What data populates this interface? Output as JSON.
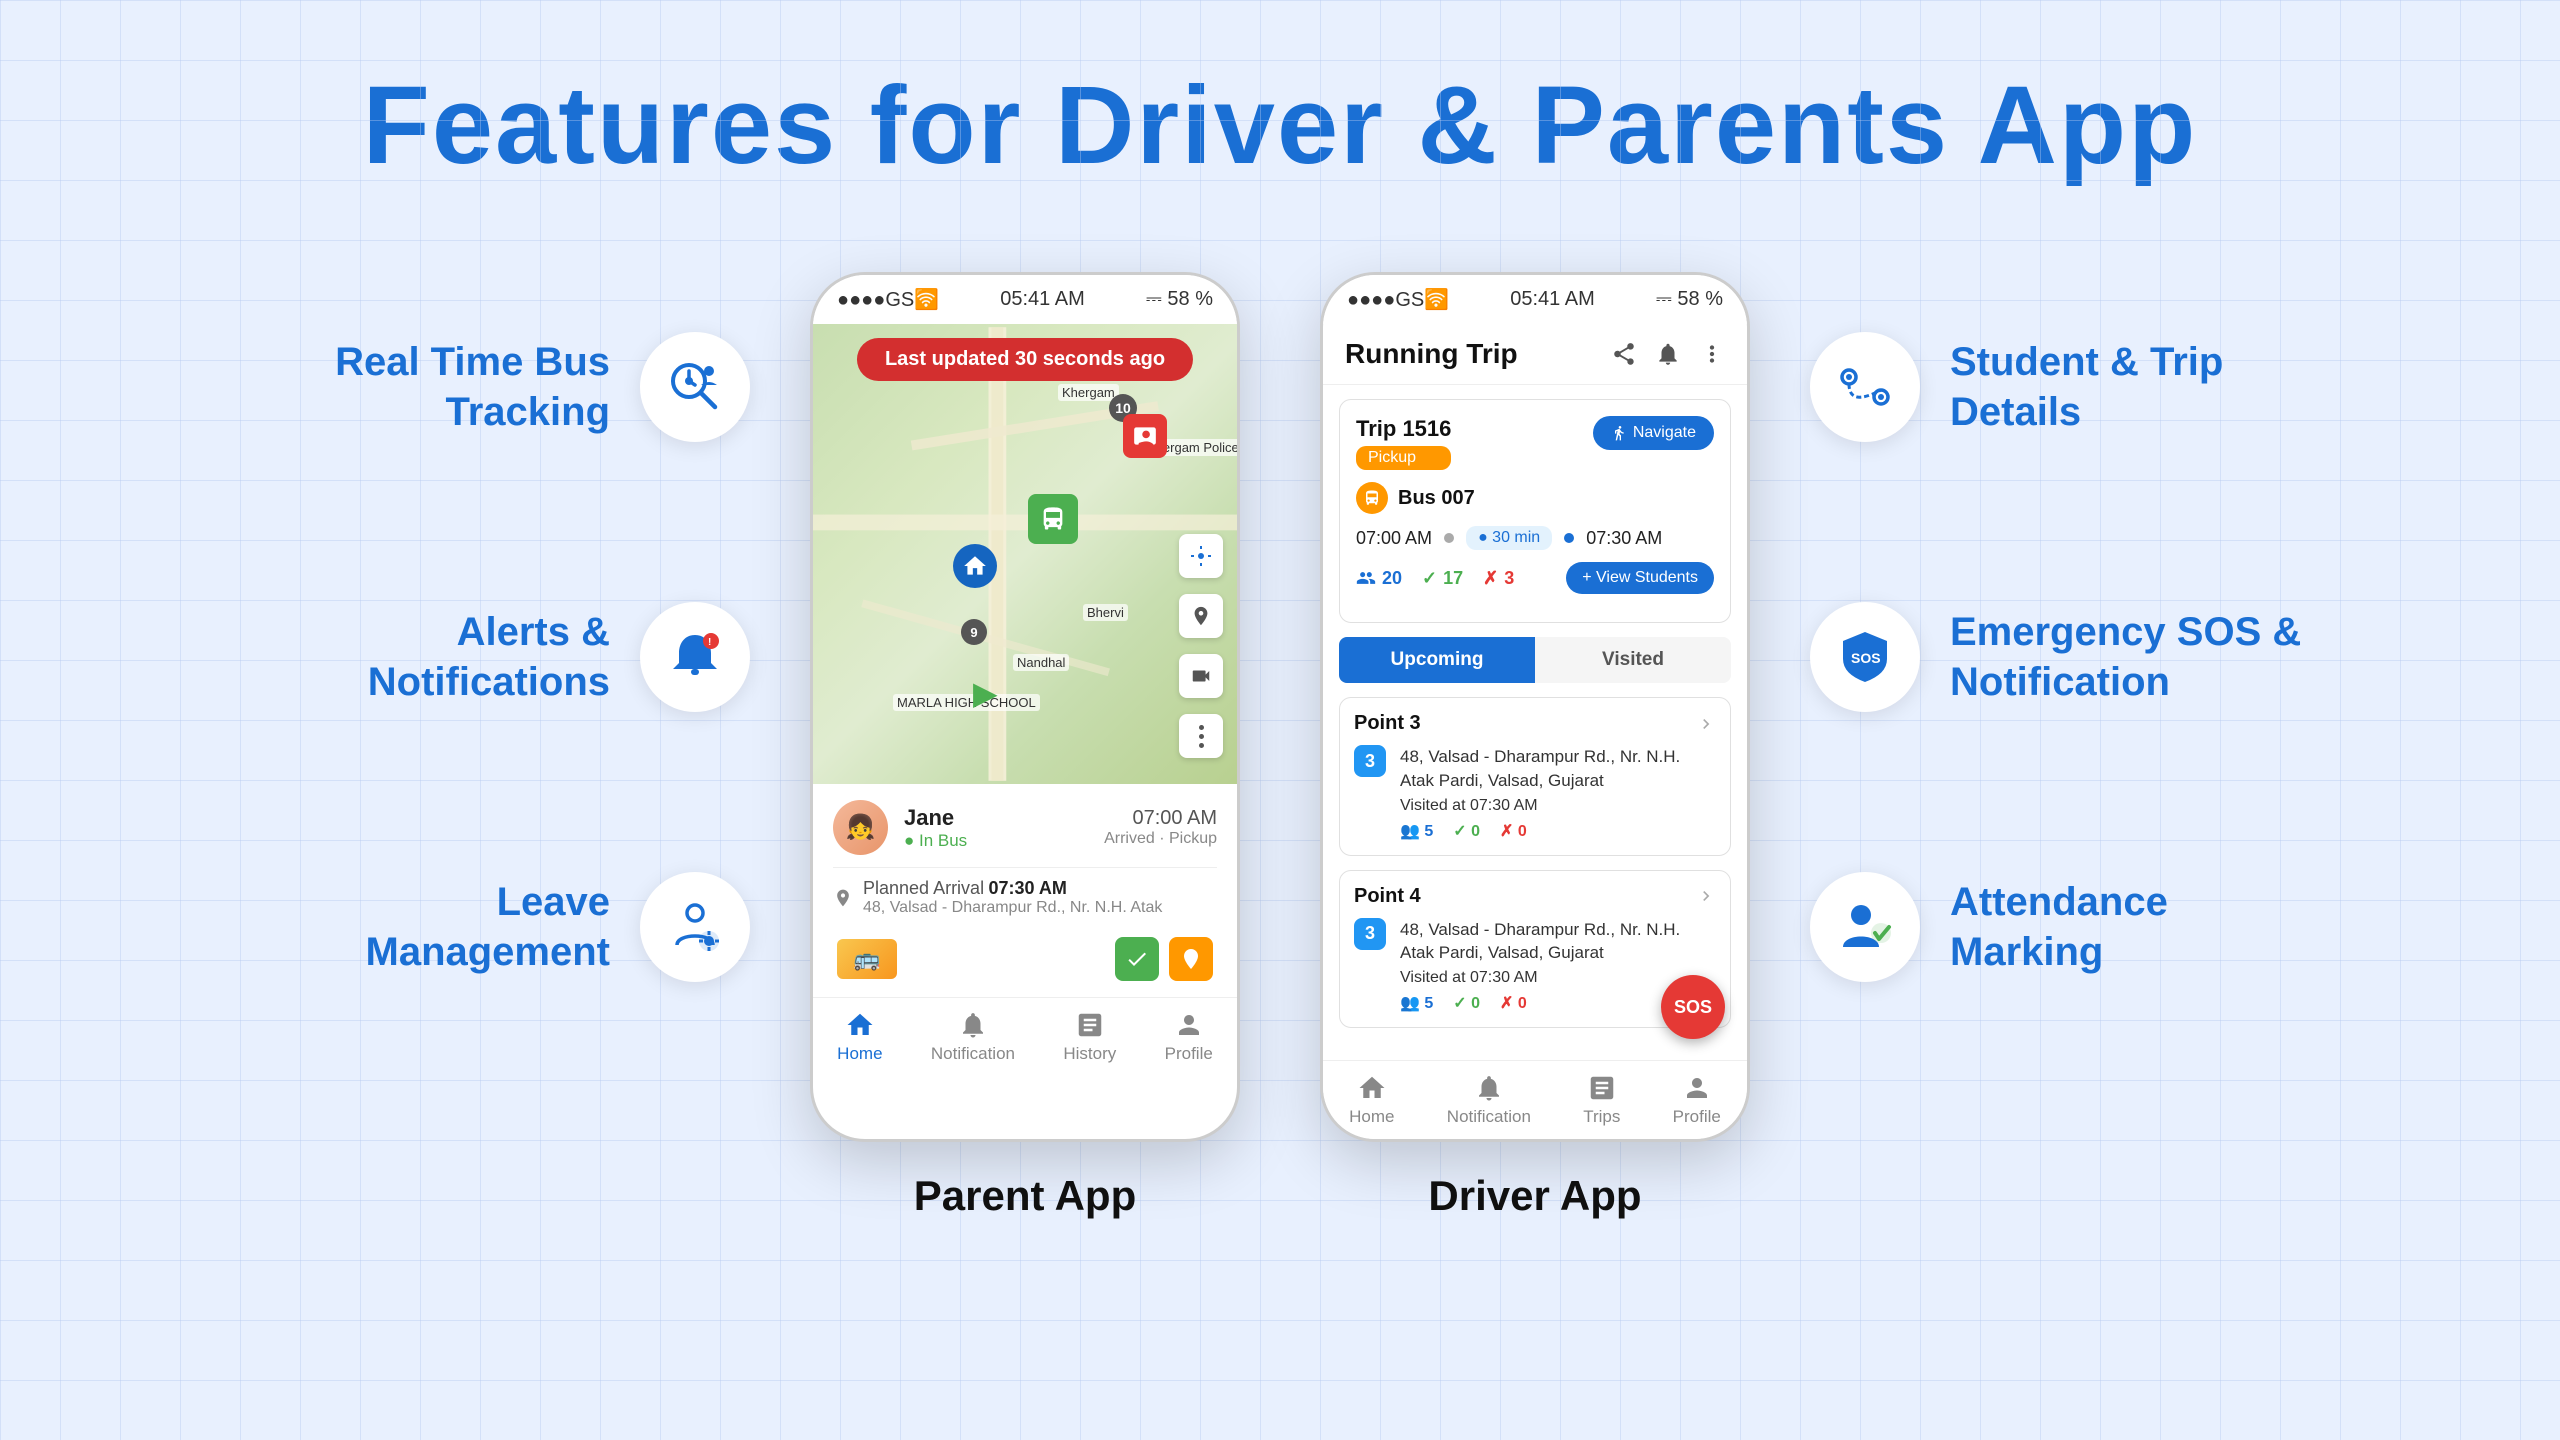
{
  "page": {
    "title": "Features for Driver  &  Parents App",
    "bg_color": "#e8f0fe",
    "accent_color": "#1a6fd4"
  },
  "features_left": [
    {
      "label": "Real Time Bus\nTracking",
      "icon": "clock-search-icon"
    },
    {
      "label": "Alerts &\nNotifications",
      "icon": "bell-icon"
    },
    {
      "label": "Leave Management",
      "icon": "hands-gear-icon"
    }
  ],
  "features_right": [
    {
      "label": "Student & Trip\nDetails",
      "icon": "route-icon"
    },
    {
      "label": "Emergency SOS &\nNotification",
      "icon": "sos-icon"
    },
    {
      "label": "Attendance Marking",
      "icon": "person-check-icon"
    }
  ],
  "parent_app": {
    "label": "Parent App",
    "status_bar": {
      "signal": "●●●●GS🛜",
      "time": "05:41 AM",
      "battery": "⎓ 58 %"
    },
    "last_updated": {
      "prefix": "Last updated",
      "highlight": "30 seconds ago"
    },
    "map_labels": [
      "Khergam",
      "Bhervi",
      "Nandhal",
      "Khergam Police Station"
    ],
    "bottom_card": {
      "student_name": "Jane",
      "student_status": "● In Bus",
      "time": "07:00 AM",
      "arrived_label": "Arrived · Pickup",
      "planned_label": "Planned Arrival",
      "planned_time": "07:30 AM",
      "address": "48, Valsad - Dharampur Rd., Nr. N.H. Atak"
    },
    "nav": [
      {
        "label": "Home",
        "active": true
      },
      {
        "label": "Notification",
        "active": false
      },
      {
        "label": "History",
        "active": false
      },
      {
        "label": "Profile",
        "active": false
      }
    ]
  },
  "driver_app": {
    "label": "Driver App",
    "status_bar": {
      "signal": "●●●●GS🛜",
      "time": "05:41 AM",
      "battery": "⎓ 58 %"
    },
    "header_title": "Running Trip",
    "trip": {
      "number": "Trip 1516",
      "type": "Pickup",
      "navigate_btn": "Navigate",
      "bus_number": "Bus 007",
      "time_start": "07:00 AM",
      "duration": "30 min",
      "time_end": "07:30 AM",
      "count_total": "20",
      "count_present": "17",
      "count_absent": "3",
      "view_students_btn": "View Students"
    },
    "tabs": [
      {
        "label": "Upcoming",
        "active": true
      },
      {
        "label": "Visited",
        "active": false
      }
    ],
    "points": [
      {
        "title": "Point 3",
        "num": "3",
        "address": "48, Valsad - Dharampur Rd., Nr. N.H. Atak Pardi, Valsad, Gujarat",
        "visited_label": "Visited at",
        "visited_time": "07:30 AM",
        "count_total": "5",
        "count_present": "0",
        "count_absent": "0"
      },
      {
        "title": "Point 4",
        "num": "3",
        "address": "48, Valsad - Dharampur Rd., Nr. N.H. Atak Pardi, Valsad, Gujarat",
        "visited_label": "Visited at",
        "visited_time": "07:30 AM",
        "count_total": "5",
        "count_present": "0",
        "count_absent": "0"
      }
    ],
    "sos_label": "SOS",
    "nav": [
      {
        "label": "Home",
        "active": false
      },
      {
        "label": "Notification",
        "active": false
      },
      {
        "label": "Trips",
        "active": false
      },
      {
        "label": "Profile",
        "active": false
      }
    ]
  }
}
